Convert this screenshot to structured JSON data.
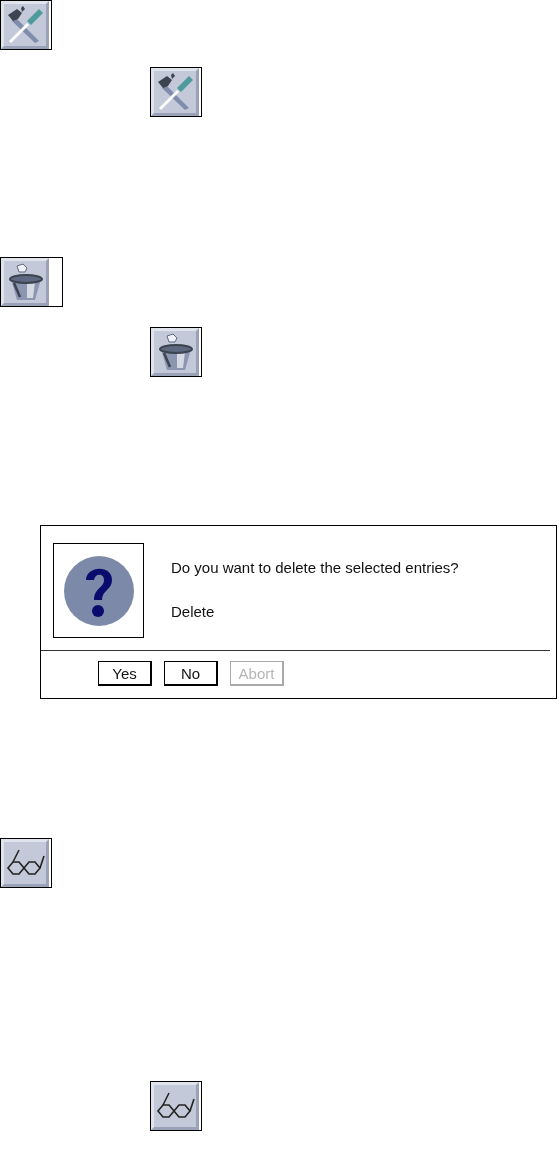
{
  "items": [
    {
      "kind": "tools"
    },
    {
      "kind": "tools"
    },
    {
      "kind": "bucket"
    },
    {
      "kind": "bucket"
    },
    {
      "kind": "dialog",
      "message": "Do you want to delete the selected entries?",
      "title": "Delete",
      "buttons": [
        {
          "label": "Yes",
          "disabled": false
        },
        {
          "label": "No",
          "disabled": false
        },
        {
          "label": "Abort",
          "disabled": true
        }
      ]
    },
    {
      "kind": "glasses"
    },
    {
      "kind": "glasses"
    }
  ]
}
